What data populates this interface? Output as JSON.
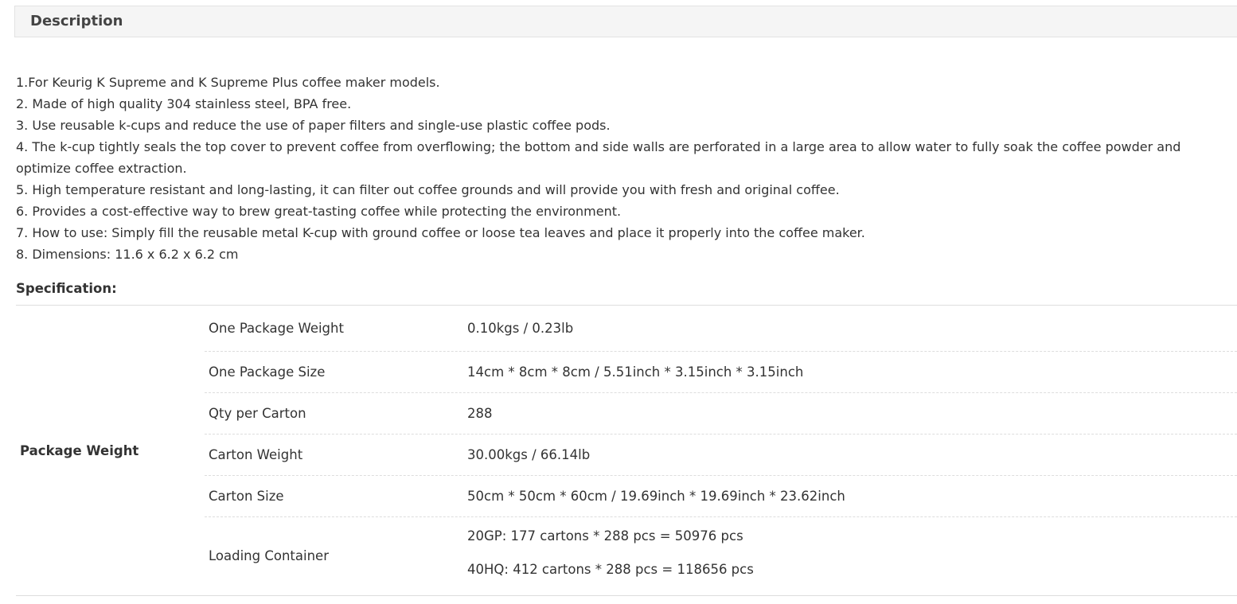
{
  "header": {
    "title": "Description"
  },
  "description": {
    "lines": [
      "1.For Keurig K Supreme and K Supreme Plus coffee maker models.",
      "2. Made of high quality 304 stainless steel, BPA free.",
      "3. Use reusable k-cups and reduce the use of paper filters and single-use plastic coffee pods.",
      "4. The k-cup tightly seals the top cover to prevent coffee from overflowing; the bottom and side walls are perforated in a large area to allow water to fully soak the coffee powder and optimize coffee extraction.",
      "5. High temperature resistant and long-lasting, it can filter out coffee grounds and will provide you with fresh and original coffee.",
      "6. Provides a cost-effective way to brew great-tasting coffee while protecting the environment.",
      "7. How to use: Simply fill the reusable metal K-cup with ground coffee or loose tea leaves and place it properly into the coffee maker.",
      "8. Dimensions: 11.6 x 6.2 x 6.2 cm"
    ]
  },
  "specification": {
    "title": "Specification:",
    "group_label": "Package Weight",
    "rows": [
      {
        "key": "One Package Weight",
        "value": "0.10kgs / 0.23lb"
      },
      {
        "key": "One Package Size",
        "value": "14cm * 8cm * 8cm / 5.51inch * 3.15inch * 3.15inch"
      },
      {
        "key": "Qty per Carton",
        "value": "288"
      },
      {
        "key": "Carton Weight",
        "value": "30.00kgs / 66.14lb"
      },
      {
        "key": "Carton Size",
        "value": "50cm * 50cm * 60cm / 19.69inch * 19.69inch * 23.62inch"
      },
      {
        "key": "Loading Container",
        "values": [
          "20GP: 177 cartons * 288 pcs = 50976 pcs",
          "40HQ: 412 cartons * 288 pcs = 118656 pcs"
        ]
      }
    ]
  }
}
